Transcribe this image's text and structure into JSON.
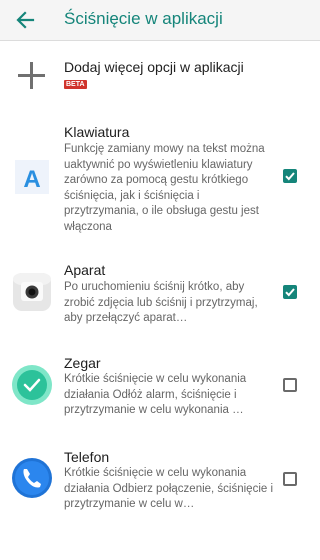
{
  "appbar": {
    "title": "Ściśnięcie w aplikacji"
  },
  "add_option": {
    "label": "Dodaj więcej opcji w aplikacji",
    "badge": "BETA"
  },
  "items": [
    {
      "title": "Klawiatura",
      "description": "Funkcję zamiany mowy na tekst można uaktywnić po wyświetleniu klawiatury zarówno za pomocą gestu krótkiego ściśnięcia, jak i ściśnięcia i przytrzymania, o ile obsługa gestu jest włączona",
      "checked": true
    },
    {
      "title": "Aparat",
      "description": "Po uruchomieniu ściśnij krótko, aby zrobić zdjęcia lub ściśnij i przytrzymaj, aby przełączyć aparat…",
      "checked": true
    },
    {
      "title": "Zegar",
      "description": "Krótkie ściśnięcie w celu wykonania działania Odłóż alarm, ściśnięcie i przytrzymanie w celu wykonania …",
      "checked": false
    },
    {
      "title": "Telefon",
      "description": "Krótkie ściśnięcie w celu wykonania działania Odbierz połączenie, ściśnięcie i przytrzymanie w celu w…",
      "checked": false
    }
  ],
  "colors": {
    "accent": "#15857a",
    "beta": "#d0342c"
  },
  "icons": {
    "back": "arrow-left-icon",
    "add": "plus-icon",
    "keyboard": "keyboard-app-icon",
    "camera": "camera-app-icon",
    "clock": "clock-app-icon",
    "phone": "phone-app-icon"
  }
}
